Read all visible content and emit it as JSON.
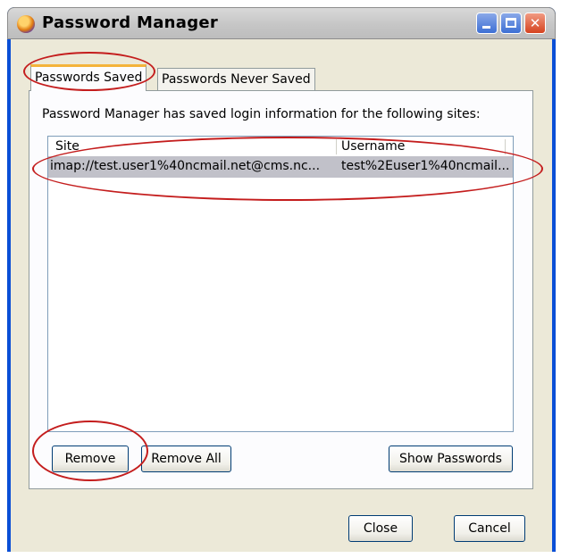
{
  "window": {
    "title": "Password Manager"
  },
  "tabs": [
    {
      "label": "Passwords Saved"
    },
    {
      "label": "Passwords Never Saved"
    }
  ],
  "panel": {
    "info": "Password Manager has saved login information for the following sites:",
    "columns": {
      "site": "Site",
      "username": "Username"
    },
    "rows": [
      {
        "site": "imap://test.user1%40ncmail.net@cms.nc...",
        "username": "test%2Euser1%40ncmail..."
      }
    ]
  },
  "buttons": {
    "remove": "Remove",
    "remove_all": "Remove All",
    "show_passwords": "Show Passwords",
    "close": "Close",
    "cancel": "Cancel"
  },
  "colors": {
    "annotation_circle": "#c41d1d",
    "selected_row": "#c1c1c9",
    "active_tab_accent": "#f4b33b"
  }
}
